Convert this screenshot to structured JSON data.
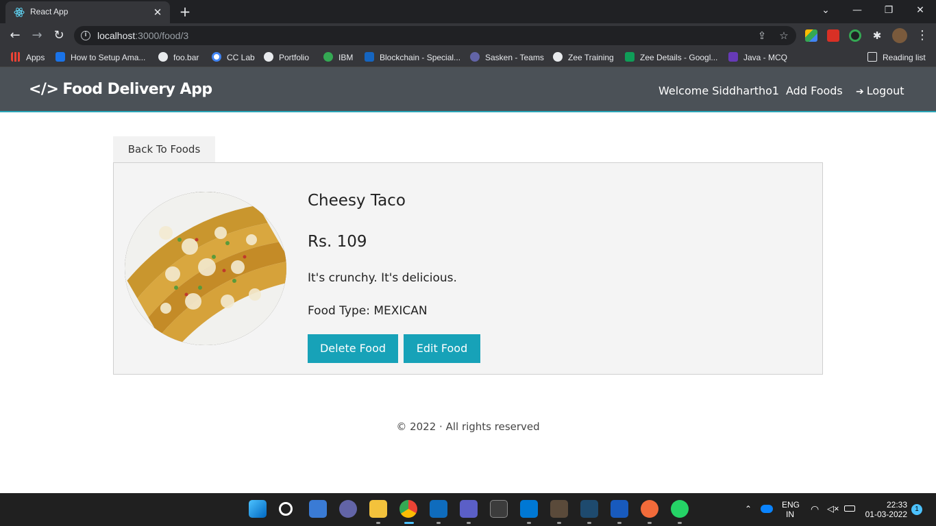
{
  "browser": {
    "tab_title": "React App",
    "url_host": "localhost",
    "url_path": ":3000/food/3",
    "bookmarks": [
      {
        "label": "Apps",
        "color": "#ea4335"
      },
      {
        "label": "How to Setup Ama...",
        "color": "#1a73e8"
      },
      {
        "label": "foo.bar",
        "color": "#e8eaed"
      },
      {
        "label": "CC Lab",
        "color": "#4285f4"
      },
      {
        "label": "Portfolio",
        "color": "#e8eaed"
      },
      {
        "label": "IBM",
        "color": "#34a853"
      },
      {
        "label": "Blockchain - Special...",
        "color": "#1565c0"
      },
      {
        "label": "Sasken - Teams",
        "color": "#6264a7"
      },
      {
        "label": "Zee Training",
        "color": "#e8eaed"
      },
      {
        "label": "Zee Details - Googl...",
        "color": "#0f9d58"
      },
      {
        "label": "Java - MCQ",
        "color": "#673ab7"
      }
    ],
    "reading_list": "Reading list"
  },
  "app": {
    "brand": "Food Delivery App",
    "welcome": "Welcome Siddhartho1",
    "add_foods": "Add Foods",
    "logout": "Logout"
  },
  "food": {
    "back_label": "Back To Foods",
    "name": "Cheesy Taco",
    "price": "Rs. 109",
    "description": "It's crunchy. It's delicious.",
    "type": "Food Type: MEXICAN",
    "delete_label": "Delete Food",
    "edit_label": "Edit Food"
  },
  "footer": "© 2022 · All rights reserved",
  "taskbar": {
    "lang_top": "ENG",
    "lang_bottom": "IN",
    "time": "22:33",
    "date": "01-03-2022",
    "notif_count": "1"
  },
  "colors": {
    "navbar": "#4b5157",
    "accent": "#17a2b8",
    "card_bg": "#f4f4f4"
  }
}
